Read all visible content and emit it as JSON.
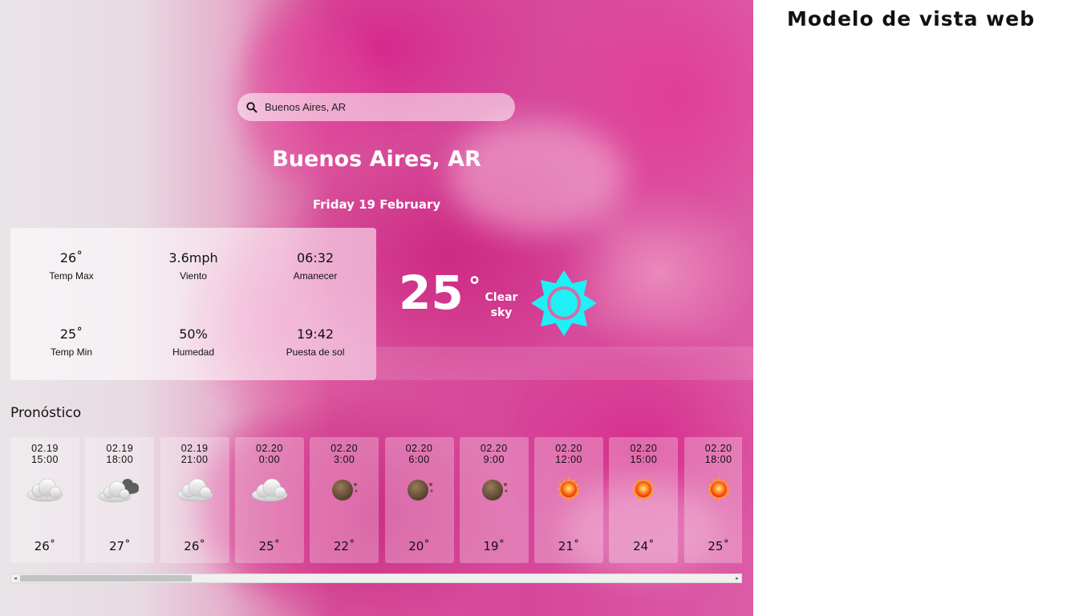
{
  "side_title": "Modelo de vista web",
  "search": {
    "value": "Buenos Aires, AR",
    "icon": "search-icon"
  },
  "location": "Buenos Aires, AR",
  "date": "Friday 19 February",
  "details": [
    {
      "value": "26˚",
      "label": "Temp Max"
    },
    {
      "value": "3.6mph",
      "label": "Viento"
    },
    {
      "value": "06:32",
      "label": "Amanecer"
    },
    {
      "value": "25˚",
      "label": "Temp Min"
    },
    {
      "value": "50%",
      "label": "Humedad"
    },
    {
      "value": "19:42",
      "label": "Puesta de sol"
    }
  ],
  "current": {
    "temp": "25",
    "degree": "°",
    "condition": "Clear sky",
    "icon": "sun-icon",
    "icon_color": "#1ef0f5"
  },
  "forecast_title": "Pronóstico",
  "forecast": [
    {
      "date": "02.19",
      "time": "15:00",
      "temp": "26˚",
      "icon": "cloud"
    },
    {
      "date": "02.19",
      "time": "18:00",
      "temp": "27˚",
      "icon": "cloud-dark"
    },
    {
      "date": "02.19",
      "time": "21:00",
      "temp": "26˚",
      "icon": "cloud"
    },
    {
      "date": "02.20",
      "time": "0:00",
      "temp": "25˚",
      "icon": "cloud"
    },
    {
      "date": "02.20",
      "time": "3:00",
      "temp": "22˚",
      "icon": "moon"
    },
    {
      "date": "02.20",
      "time": "6:00",
      "temp": "20˚",
      "icon": "moon"
    },
    {
      "date": "02.20",
      "time": "9:00",
      "temp": "19˚",
      "icon": "moon"
    },
    {
      "date": "02.20",
      "time": "12:00",
      "temp": "21˚",
      "icon": "sun"
    },
    {
      "date": "02.20",
      "time": "15:00",
      "temp": "24˚",
      "icon": "sun"
    },
    {
      "date": "02.20",
      "time": "18:00",
      "temp": "25˚",
      "icon": "sun"
    }
  ],
  "scroll": {
    "left": "◂",
    "right": "▸",
    "position": 0.24
  }
}
